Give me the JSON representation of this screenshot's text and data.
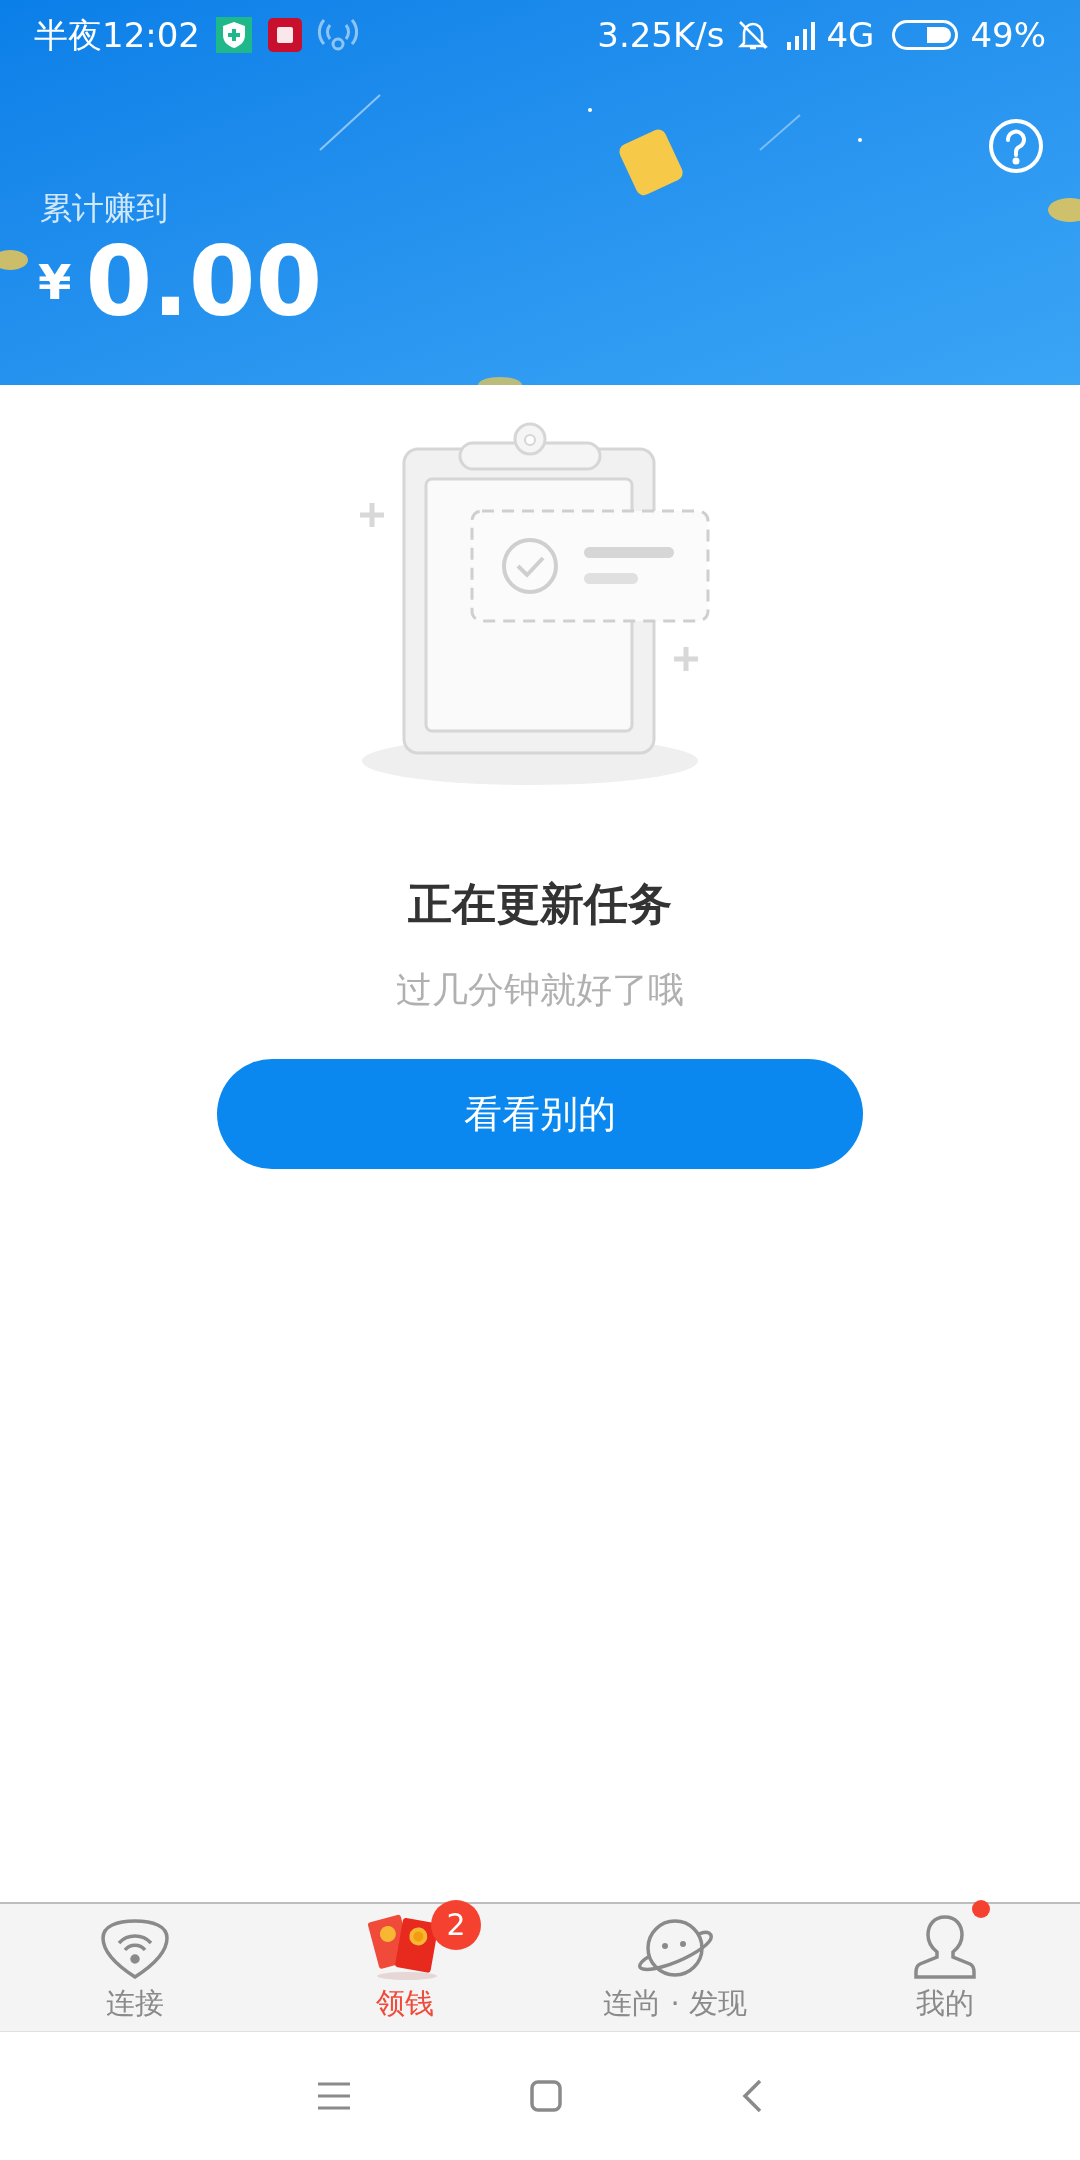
{
  "status_bar": {
    "time": "半夜12:02",
    "speed": "3.25K/s",
    "network": "4G",
    "battery": "49%"
  },
  "header": {
    "label": "累计赚到",
    "currency": "¥",
    "amount": "0.00"
  },
  "empty_state": {
    "title": "正在更新任务",
    "subtitle": "过几分钟就好了哦",
    "button": "看看别的"
  },
  "tabs": [
    {
      "label": "连接",
      "kind": "wifi",
      "selected": false
    },
    {
      "label": "领钱",
      "kind": "money",
      "selected": true,
      "badge": "2"
    },
    {
      "label": "连尚 · 发现",
      "kind": "planet",
      "selected": false
    },
    {
      "label": "我的",
      "kind": "person",
      "selected": false,
      "dot": true
    }
  ]
}
